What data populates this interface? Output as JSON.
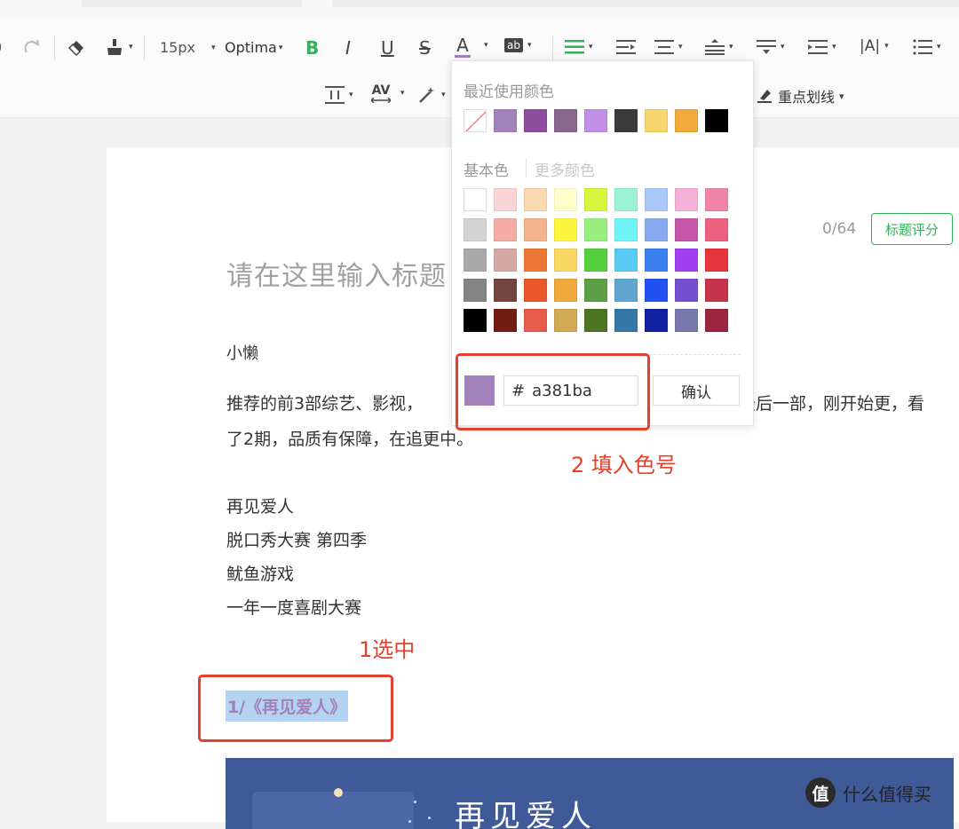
{
  "toolbar": {
    "font_size": "15px",
    "font_family": "Optima",
    "bold": "B",
    "italic": "I",
    "underline": "U",
    "strike": "S",
    "font_color": "A",
    "bg_color_label": "ab",
    "letter_spacing_label": "AV",
    "highlight_label": "重点划线",
    "accent": "#35b05a",
    "font_color_bar": "#a381ba"
  },
  "document": {
    "title_placeholder": "请在这里输入标题",
    "char_counter": "0/64",
    "score_button": "标题评分",
    "author": "小懒",
    "intro_line1_a": "推荐的前3部综艺、影视，",
    "intro_line1_b": "最后一部，刚开始更，看",
    "intro_line2": "了2期，品质有保障，在追更中。",
    "list": [
      "再见爱人",
      "脱口秀大赛 第四季",
      "鱿鱼游戏",
      "一年一度喜剧大赛"
    ],
    "selected_text": "1/《再见爱人》",
    "banner_title": "再见爱人"
  },
  "color_picker": {
    "recent_label": "最近使用颜色",
    "basic_label": "基本色",
    "more_label": "更多颜色",
    "recent_colors": [
      "none",
      "#a381ba",
      "#8e4d9d",
      "#89668b",
      "#c18ee8",
      "#3b3b3b",
      "#f7d56b",
      "#f2a93b",
      "#000000"
    ],
    "basic_colors": [
      [
        "#ffffff",
        "#f8d4d4",
        "#f8d9b0",
        "#ffffcc",
        "#d6f53c",
        "#9bf2d4",
        "#a9c7f7",
        "#f4b0d6",
        "#f084a6"
      ],
      [
        "#d3d3d3",
        "#f2aba5",
        "#f3b48d",
        "#fdf53d",
        "#98ee7c",
        "#6ff3f5",
        "#88aaf0",
        "#c556a9",
        "#ec6080"
      ],
      [
        "#a9a9a9",
        "#d4a8a5",
        "#ed7736",
        "#f8d762",
        "#55d03c",
        "#5ac9f4",
        "#3b80ef",
        "#a33df0",
        "#e8353b"
      ],
      [
        "#848484",
        "#724540",
        "#e9572a",
        "#f0a83b",
        "#5c9e48",
        "#5ea5cf",
        "#2350f0",
        "#744fd2",
        "#c6334a"
      ],
      [
        "#000000",
        "#721d14",
        "#e85a4b",
        "#d1a853",
        "#4c7522",
        "#3478aa",
        "#0f20a3",
        "#7577ad",
        "#9e2540"
      ]
    ],
    "preview_color": "#a381ba",
    "hash": "#",
    "hex_value": "a381ba",
    "confirm_button": "确认"
  },
  "annotations": {
    "step1": "1选中",
    "step2": "2 填入色号",
    "color": "#e5402c"
  },
  "watermark": {
    "logo_char": "值",
    "text": "什么值得买"
  }
}
